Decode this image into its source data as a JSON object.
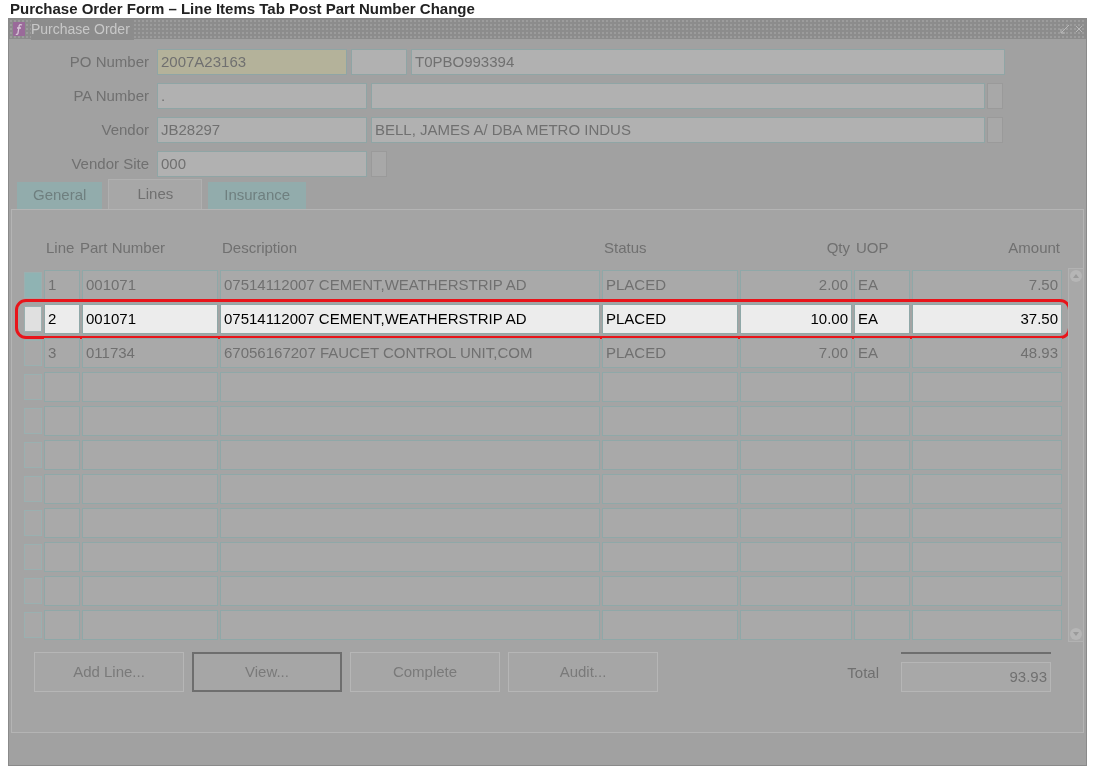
{
  "caption": "Purchase Order Form – Line Items Tab Post Part Number Change",
  "window": {
    "title": "Purchase Order"
  },
  "header": {
    "po_number": {
      "label": "PO Number",
      "value": "2007A23163",
      "reference": "T0PBO993394"
    },
    "pa_number": {
      "label": "PA Number",
      "value": "."
    },
    "vendor": {
      "label": "Vendor",
      "value": "JB28297",
      "name": "BELL, JAMES A/ DBA METRO INDUS"
    },
    "vendor_site": {
      "label": "Vendor Site",
      "value": "000"
    }
  },
  "tabs": [
    {
      "label": "General",
      "selected": false
    },
    {
      "label": "Lines",
      "selected": true
    },
    {
      "label": "Insurance",
      "selected": false
    }
  ],
  "table": {
    "columns": [
      "Line",
      "Part Number",
      "Description",
      "Status",
      "Qty",
      "UOP",
      "Amount"
    ],
    "rows": [
      {
        "line": "1",
        "part_number": "001071",
        "description": "07514112007 CEMENT,WEATHERSTRIP AD",
        "status": "PLACED",
        "qty": "2.00",
        "uop": "EA",
        "amount": "7.50",
        "selected": false
      },
      {
        "line": "2",
        "part_number": "001071",
        "description": "07514112007 CEMENT,WEATHERSTRIP AD",
        "status": "PLACED",
        "qty": "10.00",
        "uop": "EA",
        "amount": "37.50",
        "selected": true
      },
      {
        "line": "3",
        "part_number": "011734",
        "description": "67056167207 FAUCET CONTROL UNIT,COM",
        "status": "PLACED",
        "qty": "7.00",
        "uop": "EA",
        "amount": "48.93",
        "selected": false
      }
    ]
  },
  "buttons": [
    {
      "label": "Add Line...",
      "focused": false
    },
    {
      "label": "View...",
      "focused": true
    },
    {
      "label": "Complete",
      "focused": false
    },
    {
      "label": "Audit...",
      "focused": false
    }
  ],
  "total": {
    "label": "Total",
    "value": "93.93"
  }
}
